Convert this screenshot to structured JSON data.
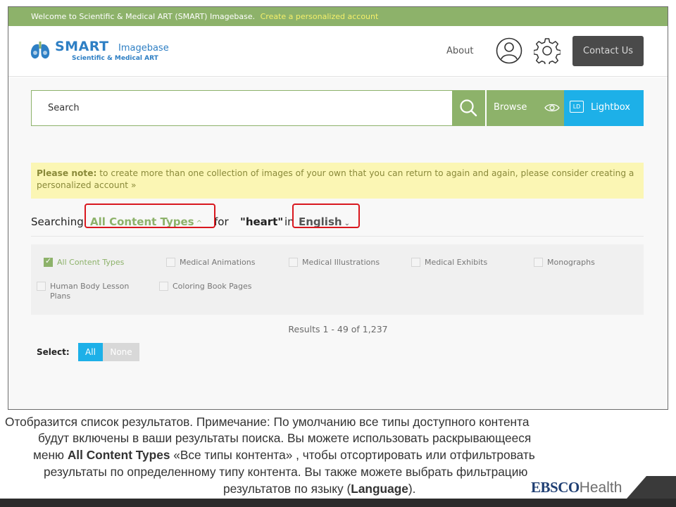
{
  "welcome_bar": {
    "text": "Welcome to Scientific & Medical ART (SMART) Imagebase.",
    "link": "Create a personalized account"
  },
  "header": {
    "logo": {
      "smart": "SMART",
      "imagebase": "Imagebase",
      "tagline": "Scientific & Medical ART"
    },
    "about": "About",
    "contact": "Contact Us",
    "icons": [
      "user-icon",
      "gear-icon"
    ]
  },
  "search": {
    "placeholder": "Search",
    "browse": "Browse",
    "lightbox_badge": "LD",
    "lightbox": "Lightbox",
    "icons": [
      "search-icon",
      "eye-icon"
    ]
  },
  "note": {
    "bold_prefix": "Please note:",
    "text": " to create more than one collection of images of your own that you can return to again and again, please consider creating a personalized account »"
  },
  "searching": {
    "prefix": "Searching",
    "content_types": "All Content Types",
    "for": "for",
    "query": "\"heart\"",
    "in": "in",
    "language": "English"
  },
  "filters": [
    {
      "label": "All Content Types",
      "checked": true
    },
    {
      "label": "Medical Animations",
      "checked": false
    },
    {
      "label": "Medical Illustrations",
      "checked": false
    },
    {
      "label": "Medical Exhibits",
      "checked": false
    },
    {
      "label": "Monographs",
      "checked": false
    },
    {
      "label": "Human Body Lesson Plans",
      "checked": false
    },
    {
      "label": "Coloring Book Pages",
      "checked": false
    }
  ],
  "results": "Results 1 - 49 of 1,237",
  "select": {
    "label": "Select:",
    "all": "All",
    "none": "None"
  },
  "caption": {
    "line1": "Отобразится список результатов. Примечание: По умолчанию все типы доступного контента",
    "line2": "будут включены в ваши результаты поиска. Вы можете использовать раскрывающееся",
    "line3_pre": "меню ",
    "line3_bold": "All Content Types",
    "line3_post": " «Все типы контента» , чтобы отсортировать или отфильтровать",
    "line4": "результаты по определенному типу контента. Вы также можете выбрать фильтрацию",
    "line5_pre": "результатов по языку (",
    "line5_bold": "Language",
    "line5_post": ")."
  },
  "branding": {
    "ebsco": "EBSCO",
    "health": "Health"
  },
  "colors": {
    "green": "#8db26a",
    "blue": "#1db0e8",
    "highlight": "#d9171e",
    "note_bg": "#fbf6b4"
  }
}
